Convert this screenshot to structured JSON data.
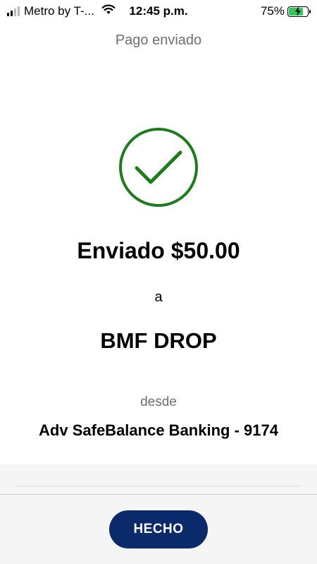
{
  "status_bar": {
    "carrier": "Metro by T-...",
    "time": "12:45 p.m.",
    "battery_percent": "75%",
    "battery_level": 0.75,
    "battery_color": "#34c759",
    "icons": [
      "signal-icon",
      "wifi-icon",
      "battery-charging-icon"
    ]
  },
  "header": {
    "title": "Pago enviado"
  },
  "confirmation": {
    "icon": "check-circle-icon",
    "icon_color": "#1e7b1e",
    "sent_amount": "Enviado $50.00",
    "to_label": "a",
    "recipient": "BMF DROP",
    "from_label": "desde",
    "account": "Adv SafeBalance Banking - 9174"
  },
  "footer": {
    "done_label": "HECHO",
    "button_color": "#0b2a6b"
  }
}
